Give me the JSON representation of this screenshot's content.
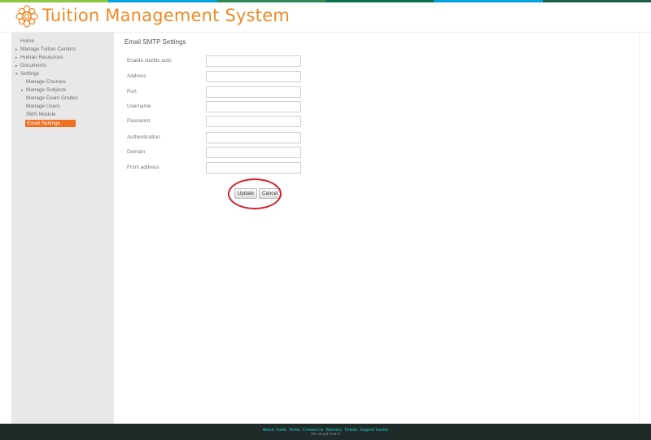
{
  "header": {
    "title": "Tuition Management System",
    "logo_icon": "flower-emblem-logo",
    "brand_color": "#f08a24",
    "top_stripe_colors": [
      "#8dc63f",
      "#00a3e0",
      "#2e8b57",
      "#0b6e4f",
      "#00a3e0",
      "#1b5e4a"
    ]
  },
  "sidebar": {
    "items": [
      {
        "label": "Home",
        "level": 0,
        "caret": ""
      },
      {
        "label": "Manage Tuition Centers",
        "level": 0,
        "caret": "right"
      },
      {
        "label": "Human Resources",
        "level": 0,
        "caret": "right"
      },
      {
        "label": "Documents",
        "level": 0,
        "caret": "right"
      },
      {
        "label": "Settings",
        "level": 0,
        "caret": "down"
      },
      {
        "label": "Manage Courses",
        "level": 1,
        "caret": ""
      },
      {
        "label": "Manage Subjects",
        "level": 1,
        "caret": "right"
      },
      {
        "label": "Manage Exam Grades",
        "level": 1,
        "caret": ""
      },
      {
        "label": "Manage Users",
        "level": 1,
        "caret": ""
      },
      {
        "label": "SMS Module",
        "level": 1,
        "caret": ""
      },
      {
        "label": "Email Settings",
        "level": 1,
        "caret": "",
        "active": true
      }
    ],
    "active_color": "#f07021"
  },
  "main": {
    "title": "Email SMTP Settings",
    "fields": [
      {
        "label": "Enable starttls auto",
        "value": "",
        "placeholder": ""
      },
      {
        "label": "Address",
        "value": "",
        "placeholder": ""
      },
      {
        "label": "Port",
        "value": "",
        "placeholder": ""
      },
      {
        "label": "Username",
        "value": "",
        "placeholder": ""
      },
      {
        "label": "Password",
        "value": "",
        "placeholder": ""
      },
      {
        "label": "Authentication",
        "value": "",
        "placeholder": ""
      },
      {
        "label": "Domain",
        "value": "",
        "placeholder": ""
      },
      {
        "label": "From address",
        "value": "",
        "placeholder": ""
      }
    ],
    "update_label": "Update",
    "cancel_label": "Cancel",
    "highlight_color": "#d21f2b"
  },
  "footer": {
    "links": [
      "About",
      "Invite",
      "Terms",
      "Contact Us",
      "Banners",
      "Tickets",
      "Support Center"
    ],
    "copyright": "The Good Grid ©",
    "link_color": "#1bc6b8",
    "background": "#1f2b29"
  }
}
